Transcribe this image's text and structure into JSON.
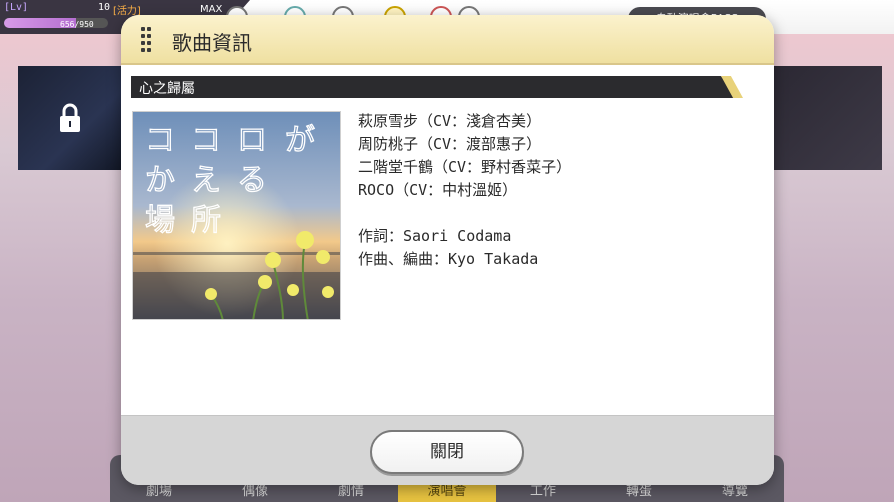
{
  "hud": {
    "lv_label": "[Lv]",
    "lv_value": "10",
    "stamina_label": "[活力]",
    "exp_text": "656/950",
    "exp_progress": 0.69,
    "max_label": "MAX",
    "top_right_pill": "自動演唱會PASS"
  },
  "dialog": {
    "title": "歌曲資訊",
    "song_title": "心之歸屬",
    "cover_art_text": [
      "コ",
      "コ",
      "ロ",
      "が",
      "か",
      "え",
      "る",
      "場",
      "所"
    ],
    "info_lines": [
      "萩原雪步（CV：淺倉杏美）",
      "周防桃子（CV：渡部惠子）",
      "二階堂千鶴（CV：野村香菜子）",
      "ROCO（CV：中村溫姬）",
      "",
      "作詞：Saori Codama",
      "作曲、編曲：Kyo Takada"
    ],
    "close_label": "關閉"
  },
  "bottom_nav": {
    "items": [
      "劇場",
      "偶像",
      "劇情",
      "演唱會",
      "工作",
      "轉蛋",
      "導覽"
    ],
    "active_index": 3
  },
  "colors": {
    "header_gold": "#efe0a1",
    "song_bar": "#2b2b2e",
    "nav_active": "#e8c340"
  }
}
